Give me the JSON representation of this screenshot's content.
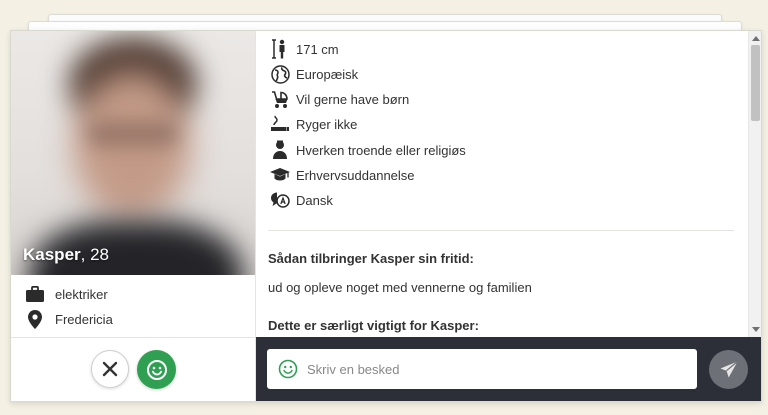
{
  "profile": {
    "name": "Kasper",
    "age_text": ", 28",
    "occupation": "elektriker",
    "city": "Fredericia"
  },
  "attributes": [
    {
      "icon": "height-icon",
      "label": "171 cm"
    },
    {
      "icon": "globe-icon",
      "label": "Europæisk"
    },
    {
      "icon": "stroller-icon",
      "label": "Vil gerne have børn"
    },
    {
      "icon": "smoking-icon",
      "label": "Ryger ikke"
    },
    {
      "icon": "religion-icon",
      "label": "Hverken troende eller religiøs"
    },
    {
      "icon": "graduation-cap-icon",
      "label": "Erhvervsuddannelse"
    },
    {
      "icon": "language-icon",
      "label": "Dansk"
    }
  ],
  "about": {
    "q1": "Sådan tilbringer Kasper sin fritid:",
    "a1": "ud og opleve noget med vennerne og familien",
    "q2": "Dette er særligt vigtigt for Kasper:"
  },
  "compose": {
    "placeholder": "Skriv en besked"
  },
  "colors": {
    "like_green": "#2fa052",
    "compose_bg": "#2c2f38",
    "page_bg": "#f4f1e4"
  }
}
